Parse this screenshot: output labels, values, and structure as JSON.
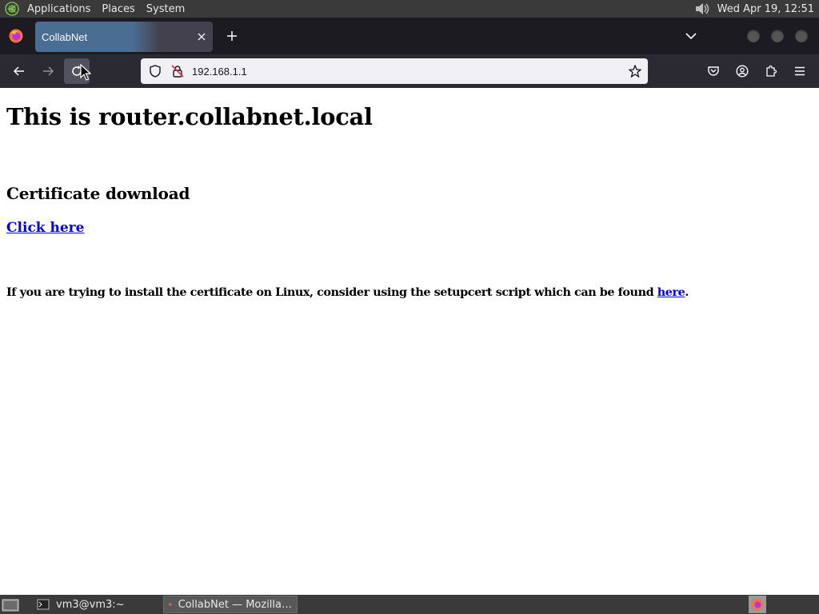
{
  "top_panel": {
    "menus": [
      "Applications",
      "Places",
      "System"
    ],
    "clock": "Wed Apr 19, 12:51"
  },
  "browser": {
    "tab_title": "CollabNet",
    "url": "192.168.1.1"
  },
  "page": {
    "heading": "This is router.collabnet.local",
    "subheading": "Certificate download",
    "download_link": "Click here",
    "note_text": "If you are trying to install the certificate on Linux, consider using the setupcert script which can be found ",
    "note_link": "here",
    "note_end": "."
  },
  "taskbar": {
    "tasks": [
      {
        "label": "vm3@vm3:~",
        "active": false
      },
      {
        "label": "CollabNet — Mozilla…",
        "active": true
      }
    ]
  },
  "colors": {
    "panel": "#3a3a3a",
    "tabstrip": "#1c1b22",
    "toolbar": "#2b2a33",
    "active_tab": "#4a6d93",
    "link": "#0000ee"
  }
}
